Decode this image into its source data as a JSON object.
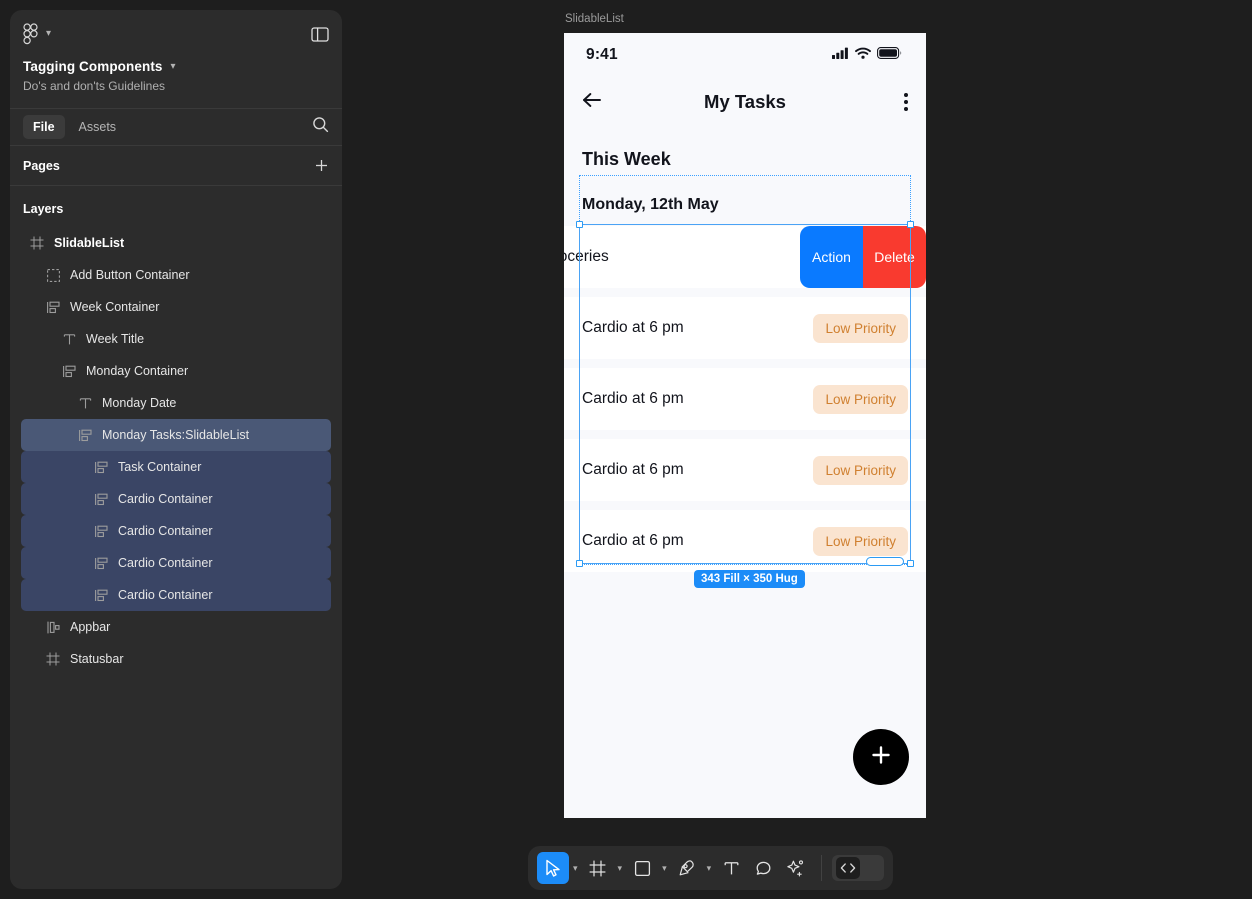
{
  "left_panel": {
    "brand_icon": "figma-logo-icon",
    "brand_chevron": "chevron-down-icon",
    "panel_toggle_icon": "panel-toggle-icon",
    "file_title": "Tagging Components",
    "file_title_chevron": "chevron-down-icon",
    "file_subtitle": "Do's and don'ts Guidelines",
    "tabs": [
      {
        "label": "File",
        "active": true
      },
      {
        "label": "Assets",
        "active": false
      }
    ],
    "search_icon": "search-icon",
    "pages_label": "Pages",
    "pages_add_icon": "plus-icon",
    "layers_label": "Layers",
    "layers": [
      {
        "label": "SlidableList",
        "icon": "frame-icon",
        "indent": 0,
        "bold": true,
        "state": "none"
      },
      {
        "label": "Add Button Container",
        "icon": "group-icon",
        "indent": 1,
        "bold": false,
        "state": "none"
      },
      {
        "label": "Week Container",
        "icon": "autolayout-vertical-icon",
        "indent": 1,
        "bold": false,
        "state": "none"
      },
      {
        "label": "Week Title",
        "icon": "text-icon",
        "indent": 2,
        "bold": false,
        "state": "none"
      },
      {
        "label": "Monday Container",
        "icon": "autolayout-vertical-icon",
        "indent": 2,
        "bold": false,
        "state": "none"
      },
      {
        "label": "Monday Date",
        "icon": "text-icon",
        "indent": 3,
        "bold": false,
        "state": "none"
      },
      {
        "label": "Monday Tasks:SlidableList",
        "icon": "autolayout-vertical-icon",
        "indent": 3,
        "bold": false,
        "state": "selected"
      },
      {
        "label": "Task Container",
        "icon": "autolayout-vertical-icon",
        "indent": 4,
        "bold": false,
        "state": "child-selected"
      },
      {
        "label": "Cardio Container",
        "icon": "autolayout-vertical-icon",
        "indent": 4,
        "bold": false,
        "state": "child-selected"
      },
      {
        "label": "Cardio Container",
        "icon": "autolayout-vertical-icon",
        "indent": 4,
        "bold": false,
        "state": "child-selected"
      },
      {
        "label": "Cardio Container",
        "icon": "autolayout-vertical-icon",
        "indent": 4,
        "bold": false,
        "state": "child-selected"
      },
      {
        "label": "Cardio Container",
        "icon": "autolayout-vertical-icon",
        "indent": 4,
        "bold": false,
        "state": "child-selected"
      },
      {
        "label": "Appbar",
        "icon": "autolayout-horizontal-icon",
        "indent": 1,
        "bold": false,
        "state": "none"
      },
      {
        "label": "Statusbar",
        "icon": "frame-icon",
        "indent": 1,
        "bold": false,
        "state": "none"
      }
    ]
  },
  "canvas": {
    "frame_name": "SlidableList",
    "selection_dimensions": "343 Fill × 350 Hug",
    "phone": {
      "statusbar": {
        "time": "9:41",
        "icons": [
          "cellular-signal-icon",
          "wifi-icon",
          "battery-icon"
        ]
      },
      "appbar": {
        "back_icon": "arrow-left-icon",
        "title": "My Tasks",
        "more_icon": "more-vertical-icon"
      },
      "week_title": "This Week",
      "monday_date": "Monday, 12th May",
      "tasks": [
        {
          "label": "groceries",
          "slid_open": true,
          "actions": [
            {
              "label": "Action",
              "color": "#0a7aff"
            },
            {
              "label": "Delete",
              "color": "#f93a2f"
            }
          ]
        },
        {
          "label": "Cardio at 6 pm",
          "badge": "Low Priority",
          "slid_open": false
        },
        {
          "label": "Cardio at 6 pm",
          "badge": "Low Priority",
          "slid_open": false
        },
        {
          "label": "Cardio at 6 pm",
          "badge": "Low Priority",
          "slid_open": false
        },
        {
          "label": "Cardio at 6 pm",
          "badge": "Low Priority",
          "slid_open": false
        }
      ],
      "fab_icon": "plus-icon"
    }
  },
  "toolbar": {
    "tools": [
      {
        "name": "move-tool",
        "icon": "cursor-icon",
        "active": true,
        "chevron": true
      },
      {
        "name": "frame-tool",
        "icon": "frame-icon",
        "active": false,
        "chevron": true
      },
      {
        "name": "shape-tool",
        "icon": "rectangle-icon",
        "active": false,
        "chevron": true
      },
      {
        "name": "pen-tool",
        "icon": "pen-icon",
        "active": false,
        "chevron": true
      },
      {
        "name": "text-tool",
        "icon": "text-icon",
        "active": false,
        "chevron": false
      },
      {
        "name": "comment-tool",
        "icon": "comment-icon",
        "active": false,
        "chevron": false
      },
      {
        "name": "actions-tool",
        "icon": "sparkle-icon",
        "active": false,
        "chevron": false
      }
    ],
    "code_toggle_icon": "code-icon"
  },
  "colors": {
    "accent_blue": "#1c8cf8",
    "action_blue": "#0a7aff",
    "delete_red": "#f93a2f",
    "badge_bg": "#fae4d0",
    "badge_text": "#d08030",
    "panel_bg": "#2c2c2c",
    "canvas_bg": "#1e1e1e",
    "selection_row": "#4a5876",
    "selection_child_row": "#3a4565"
  }
}
